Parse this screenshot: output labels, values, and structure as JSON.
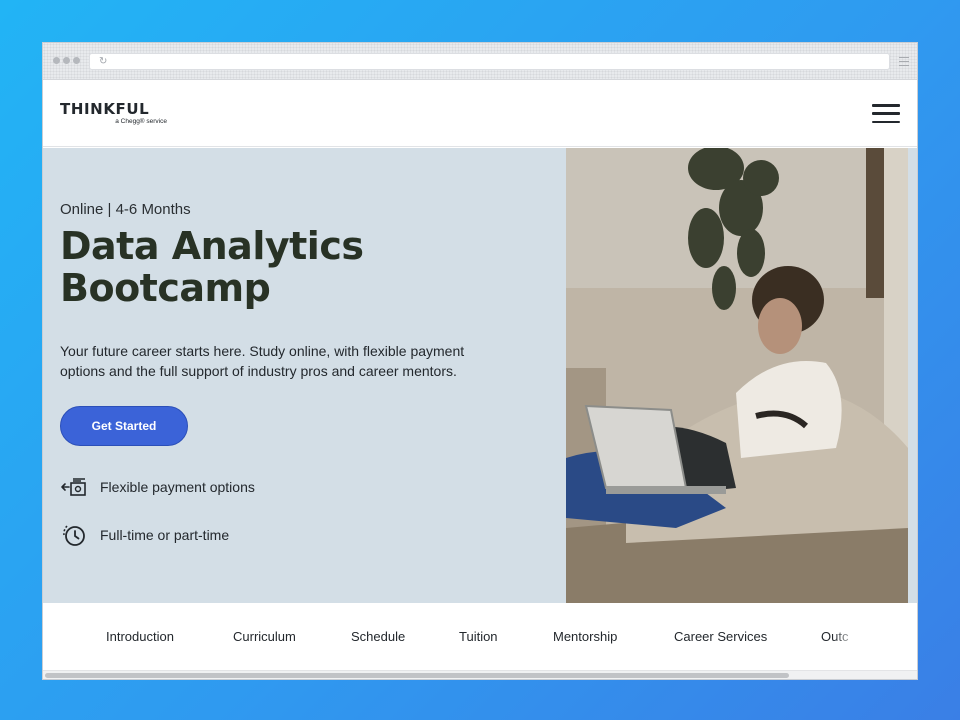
{
  "header": {
    "logo_main": "THINKFUL",
    "logo_sub": "a Chegg® service",
    "menu_icon": "hamburger-menu-icon"
  },
  "hero": {
    "eyebrow": "Online | 4-6 Months",
    "title_line1": "Data Analytics",
    "title_line2": "Bootcamp",
    "description": "Your future career starts here. Study online, with flexible payment options and the full support of industry pros and career mentors.",
    "cta_label": "Get Started",
    "features": [
      {
        "icon": "payment-icon",
        "label": "Flexible payment options"
      },
      {
        "icon": "clock-icon",
        "label": "Full-time or part-time"
      }
    ]
  },
  "tabs": [
    "Introduction",
    "Curriculum",
    "Schedule",
    "Tuition",
    "Mentorship",
    "Career Services",
    "Outc"
  ],
  "colors": {
    "accent": "#3b63d8",
    "hero_bg": "#d3dee6",
    "title": "#283225"
  }
}
